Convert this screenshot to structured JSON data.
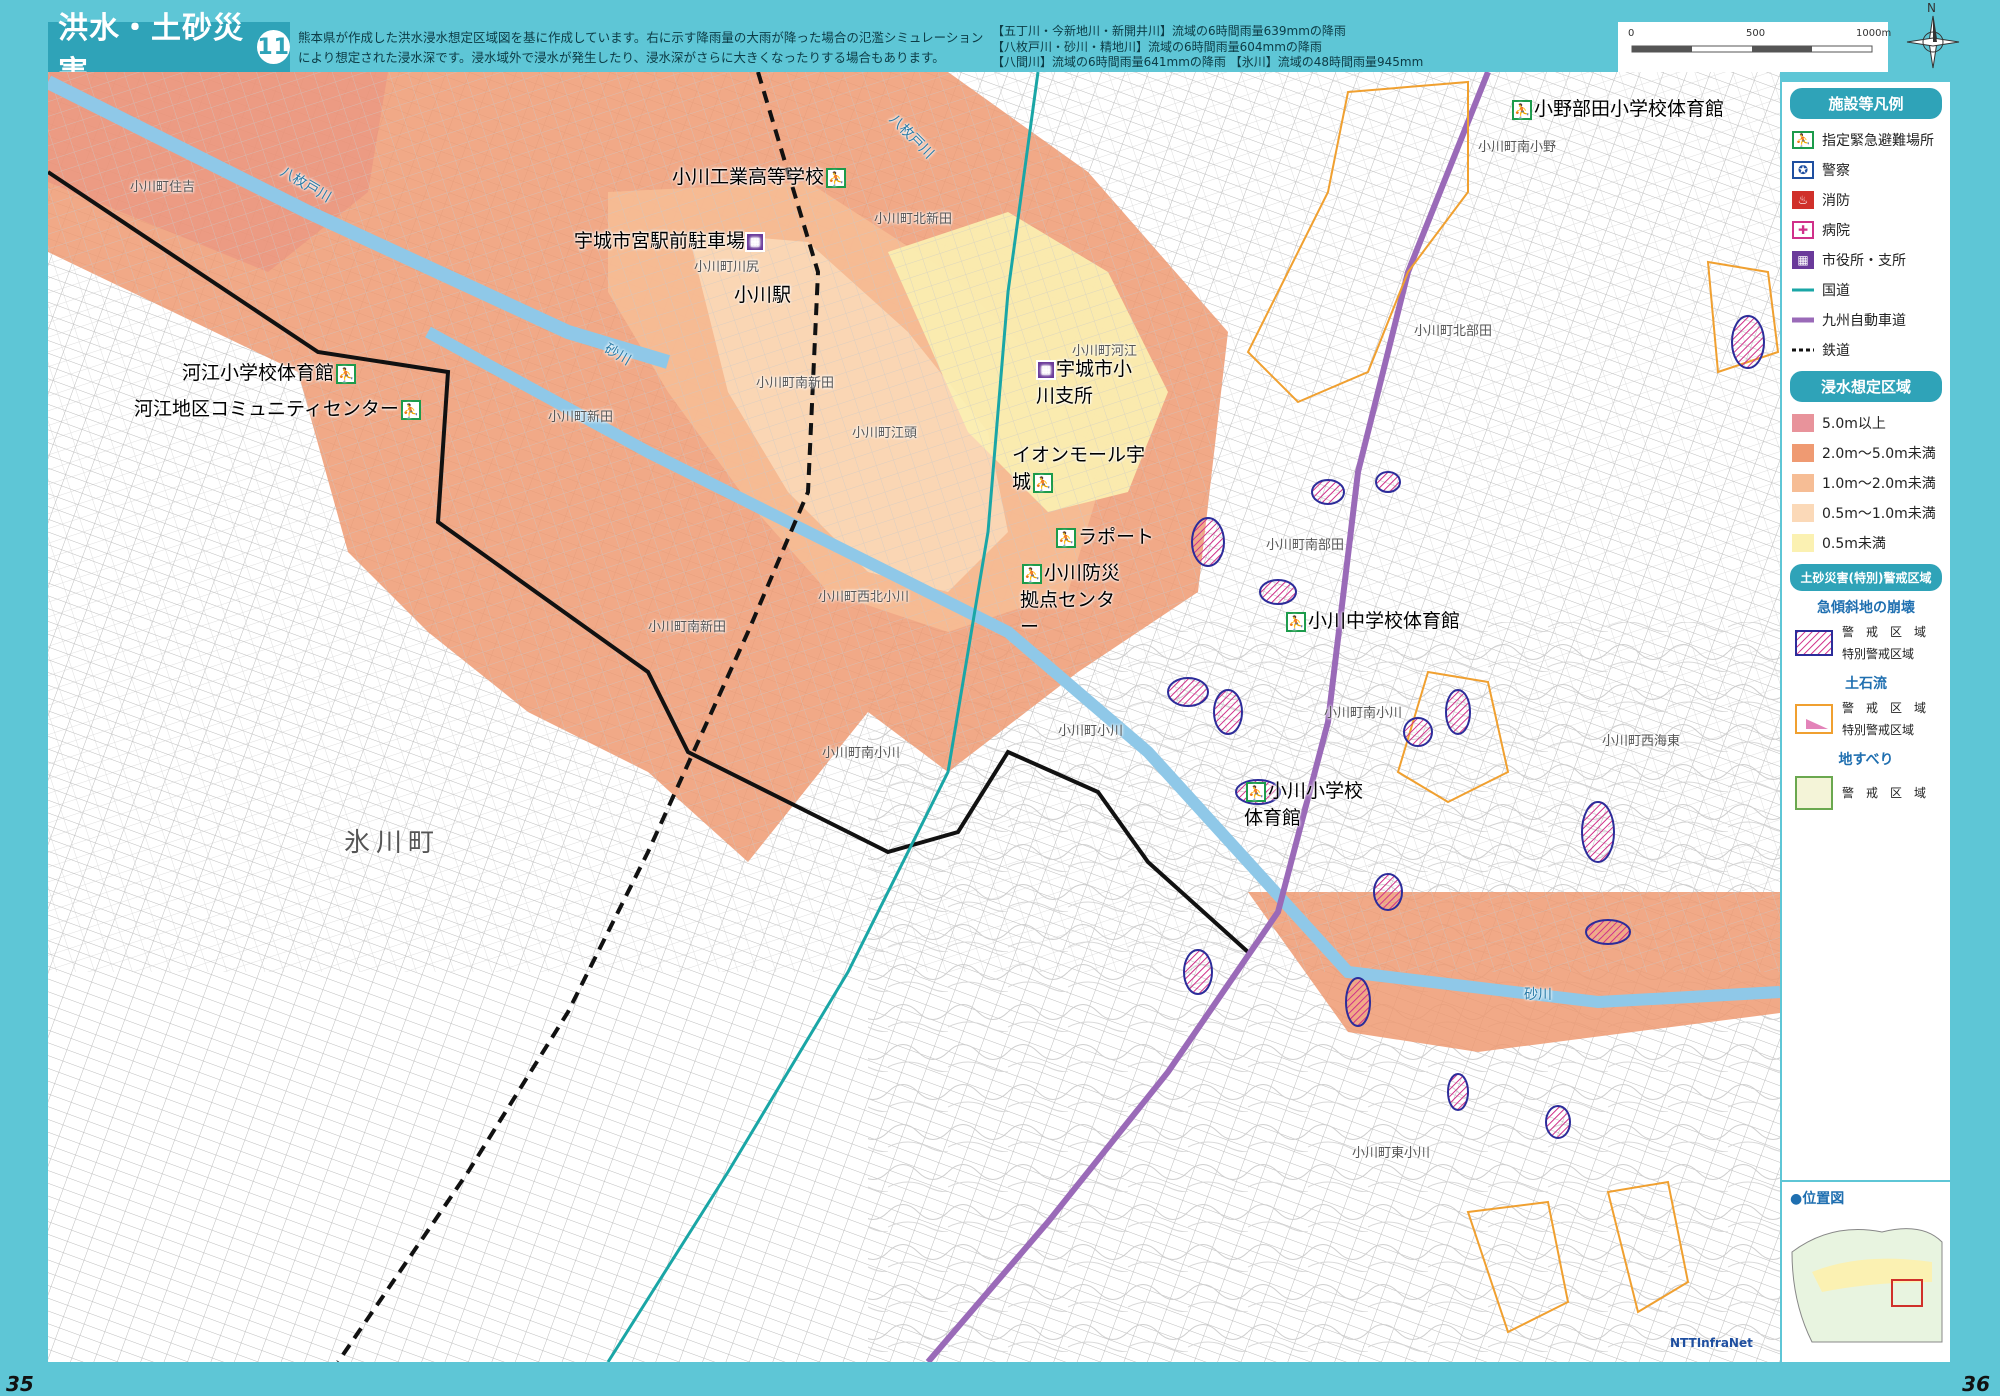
{
  "header": {
    "title": "洪水・土砂災害",
    "number": "11",
    "description": "熊本県が作成した洪水浸水想定区域図を基に作成しています。右に示す降雨量の大雨が降った場合の氾濫シミュレーションにより想定された浸水深です。浸水域外で浸水が発生したり、浸水深がさらに大きくなったりする場合もあります。",
    "rain_lines": [
      "【五丁川・今新地川・新開井川】流域の6時間雨量639mmの降雨",
      "【八枚戸川・砂川・精地川】流域の6時間雨量604mmの降雨",
      "【八間川】流域の6時間雨量641mmの降雨 【氷川】流域の48時間雨量945mm"
    ]
  },
  "scale": {
    "ticks": [
      "0",
      "500",
      "1000m"
    ]
  },
  "compass": {
    "label": "N"
  },
  "map": {
    "facility_labels": [
      {
        "name": "小野部田小学校体育館",
        "icon": "evac"
      },
      {
        "name": "小川工業高等学校",
        "icon": "evac"
      },
      {
        "name": "宇城市宮駅前駐車場",
        "icon": "cityhall"
      },
      {
        "name": "小川駅",
        "icon": "none"
      },
      {
        "name": "河江小学校体育館",
        "icon": "evac"
      },
      {
        "name": "河江地区コミュニティセンター",
        "icon": "evac"
      },
      {
        "name": "宇城市小川支所",
        "icon": "cityhall"
      },
      {
        "name": "イオンモール宇城",
        "icon": "evac"
      },
      {
        "name": "ラポート",
        "icon": "evac"
      },
      {
        "name": "小川防災拠点センター",
        "icon": "evac"
      },
      {
        "name": "小川中学校体育館",
        "icon": "evac"
      },
      {
        "name": "小川小学校体育館",
        "icon": "evac"
      }
    ],
    "place_names": [
      "小川町住吉",
      "小川町北新田",
      "小川町川尻",
      "小川町南新田",
      "小川町新田",
      "小川町江頭",
      "小川町河江",
      "小川町西北小川",
      "小川町南新田",
      "小川町南小川",
      "小川町小川",
      "小川町南小野",
      "小川町北部田",
      "小川町南部田",
      "小川町南小川",
      "小川町西海東",
      "小川町東小川"
    ],
    "town_big": "氷川町",
    "rivers": [
      "八枚戸川",
      "八枚戸川",
      "砂川",
      "砂川"
    ]
  },
  "legend": {
    "facilities_title": "施設等凡例",
    "facilities": [
      {
        "icon": "evac-icon",
        "label": "指定緊急避難場所"
      },
      {
        "icon": "police-icon",
        "label": "警察"
      },
      {
        "icon": "fire-icon",
        "label": "消防"
      },
      {
        "icon": "hospital-icon",
        "label": "病院"
      },
      {
        "icon": "cityhall-icon",
        "label": "市役所・支所"
      },
      {
        "icon": "national-road",
        "label": "国道"
      },
      {
        "icon": "expressway",
        "label": "九州自動車道"
      },
      {
        "icon": "railway",
        "label": "鉄道"
      }
    ],
    "flood_title": "浸水想定区域",
    "flood_levels": [
      {
        "label": "5.0m以上",
        "color": "#e8939b"
      },
      {
        "label": "2.0m〜5.0m未満",
        "color": "#ef9a72"
      },
      {
        "label": "1.0m〜2.0m未満",
        "color": "#f6bd95"
      },
      {
        "label": "0.5m〜1.0m未満",
        "color": "#fbd9b8"
      },
      {
        "label": "0.5m未満",
        "color": "#fbf1b2"
      }
    ],
    "sediment_title": "土砂災害(特別)警戒区域",
    "steep_slope_title": "急傾斜地の崩壊",
    "steep_slope_items": [
      "警　戒　区　域",
      "特別警戒区域"
    ],
    "debris_flow_title": "土石流",
    "debris_flow_items": [
      "警　戒　区　域",
      "特別警戒区域"
    ],
    "landslide_title": "地すべり",
    "landslide_items": [
      "警　戒　区　域"
    ],
    "locator_title": "●位置図"
  },
  "footer": {
    "page_left": "35",
    "page_right": "36",
    "credit": "NTTInfraNet"
  },
  "colors": {
    "teal": "#5ec6d6",
    "flood_5m": "#e8939b",
    "flood_2m": "#ef9a72",
    "flood_1m": "#f6bd95",
    "flood_05m": "#fbd9b8",
    "flood_lt05": "#fbf1b2",
    "national_road": "#1aa6a6",
    "expressway": "#9a6ab8",
    "steep_slope": "#2c2c9a",
    "debris_flow": "#f0a030",
    "special_zone": "#d0308a"
  }
}
